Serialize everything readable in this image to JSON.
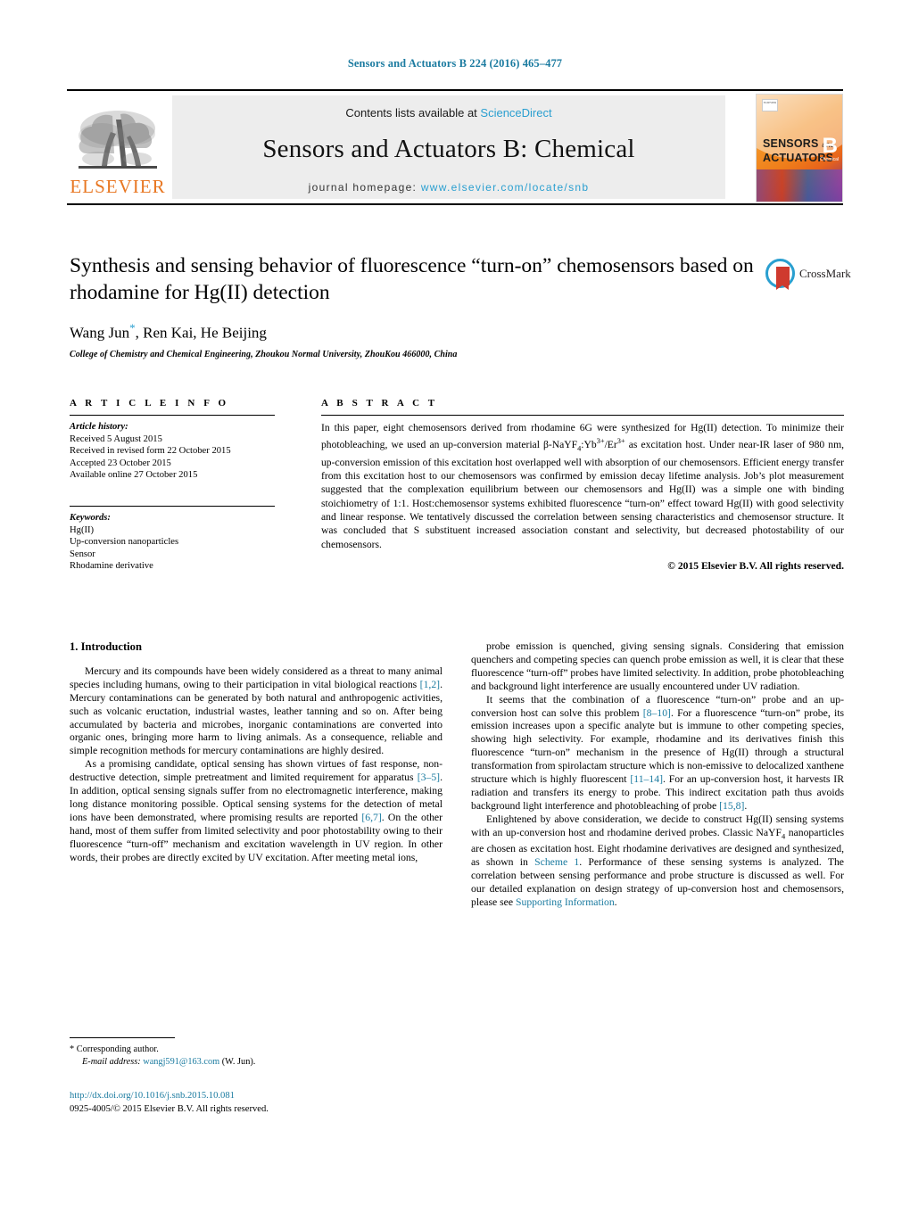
{
  "running_head": "Sensors and Actuators B 224 (2016) 465–477",
  "masthead": {
    "publisher_logo_text": "ELSEVIER",
    "contents_prefix": "Contents lists available at ",
    "contents_link": "ScienceDirect",
    "journal_title": "Sensors and Actuators B: Chemical",
    "homepage_prefix": "journal homepage: ",
    "homepage_url": "www.elsevier.com/locate/snb",
    "cover": {
      "line1": "SENSORS",
      "line1_small": "and",
      "line2": "ACTUATORS",
      "letter": "B",
      "letter_sub": "Chemical",
      "badge": "ELSEVIER"
    }
  },
  "article": {
    "title": "Synthesis and sensing behavior of fluorescence “turn-on” chemosensors based on rhodamine for Hg(II) detection",
    "authors": "Wang Jun",
    "authors_rest": ", Ren Kai, He Beijing",
    "corresponding_marker": "*",
    "affiliation": "College of Chemistry and Chemical Engineering, Zhoukou Normal University, ZhouKou 466000, China",
    "crossmark_label": "CrossMark"
  },
  "info": {
    "heading": "A R T I C L E   I N F O",
    "history_title": "Article history:",
    "history": [
      "Received 5 August 2015",
      "Received in revised form 22 October 2015",
      "Accepted 23 October 2015",
      "Available online 27 October 2015"
    ],
    "keywords_title": "Keywords:",
    "keywords": [
      "Hg(II)",
      "Up-conversion nanoparticles",
      "Sensor",
      "Rhodamine derivative"
    ]
  },
  "abstract": {
    "heading": "A B S T R A C T",
    "text": "In this paper, eight chemosensors derived from rhodamine 6G were synthesized for Hg(II) detection. To minimize their photobleaching, we used an up-conversion material β-NaYF4:Yb3+/Er3+ as excitation host. Under near-IR laser of 980 nm, up-conversion emission of this excitation host overlapped well with absorption of our chemosensors. Efficient energy transfer from this excitation host to our chemosensors was confirmed by emission decay lifetime analysis. Job’s plot measurement suggested that the complexation equilibrium between our chemosensors and Hg(II) was a simple one with binding stoichiometry of 1:1. Host:chemosensor systems exhibited fluorescence “turn-on” effect toward Hg(II) with good selectivity and linear response. We tentatively discussed the correlation between sensing characteristics and chemosensor structure. It was concluded that S substituent increased association constant and selectivity, but decreased photostability of our chemosensors.",
    "copyright": "© 2015 Elsevier B.V. All rights reserved."
  },
  "body": {
    "section_heading": "1.  Introduction",
    "left_paragraphs": [
      "Mercury and its compounds have been widely considered as a threat to many animal species including humans, owing to their participation in vital biological reactions [1,2]. Mercury contaminations can be generated by both natural and anthropogenic activities, such as volcanic eructation, industrial wastes, leather tanning and so on. After being accumulated by bacteria and microbes, inorganic contaminations are converted into organic ones, bringing more harm to living animals. As a consequence, reliable and simple recognition methods for mercury contaminations are highly desired.",
      "As a promising candidate, optical sensing has shown virtues of fast response, non-destructive detection, simple pretreatment and limited requirement for apparatus [3–5]. In addition, optical sensing signals suffer from no electromagnetic interference, making long distance monitoring possible. Optical sensing systems for the detection of metal ions have been demonstrated, where promising results are reported [6,7]. On the other hand, most of them suffer from limited selectivity and poor photostability owing to their fluorescence “turn-off” mechanism and excitation wavelength in UV region. In other words, their probes are directly excited by UV excitation. After meeting metal ions,"
    ],
    "right_paragraphs": [
      "probe emission is quenched, giving sensing signals. Considering that emission quenchers and competing species can quench probe emission as well, it is clear that these fluorescence “turn-off” probes have limited selectivity. In addition, probe photobleaching and background light interference are usually encountered under UV radiation.",
      "It seems that the combination of a fluorescence “turn-on” probe and an up-conversion host can solve this problem [8–10]. For a fluorescence “turn-on” probe, its emission increases upon a specific analyte but is immune to other competing species, showing high selectivity. For example, rhodamine and its derivatives finish this fluorescence “turn-on” mechanism in the presence of Hg(II) through a structural transformation from spirolactam structure which is non-emissive to delocalized xanthene structure which is highly fluorescent [11–14]. For an up-conversion host, it harvests IR radiation and transfers its energy to probe. This indirect excitation path thus avoids background light interference and photobleaching of probe [15,8].",
      "Enlightened by above consideration, we decide to construct Hg(II) sensing systems with an up-conversion host and rhodamine derived probes. Classic NaYF4 nanoparticles are chosen as excitation host. Eight rhodamine derivatives are designed and synthesized, as shown in Scheme 1. Performance of these sensing systems is analyzed. The correlation between sensing performance and probe structure is discussed as well. For our detailed explanation on design strategy of up-conversion host and chemosensors, please see Supporting Information."
    ],
    "inline_links": {
      "ref_1_2": "[1,2]",
      "ref_3_5": "[3–5]",
      "ref_6_7": "[6,7]",
      "ref_8_10": "[8–10]",
      "ref_11_14": "[11–14]",
      "ref_15_8": "[15,8]",
      "scheme_1": "Scheme 1",
      "supporting_information": "Supporting Information"
    }
  },
  "footer": {
    "corresponding_note": "* Corresponding author.",
    "email_label": "E-mail address:",
    "email": "wangj591@163.com",
    "email_suffix": "(W. Jun).",
    "doi": "http://dx.doi.org/10.1016/j.snb.2015.10.081",
    "issn_line": "0925-4005/© 2015 Elsevier B.V. All rights reserved."
  },
  "colors": {
    "link": "#1b7ba0",
    "sciencedirect": "#2a9fd0",
    "elsevier_orange": "#e87722",
    "band_gray": "#ededed"
  }
}
